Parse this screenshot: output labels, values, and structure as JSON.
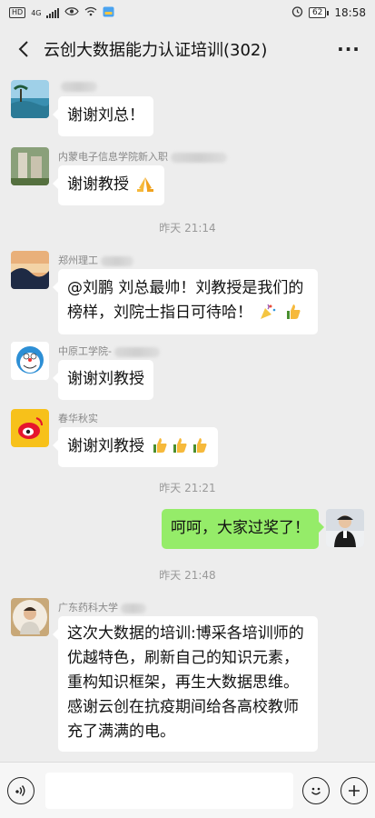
{
  "status_bar": {
    "hd_label": "HD",
    "network_label": "4G",
    "battery_level": "62",
    "time": "18:58"
  },
  "header": {
    "title": "云创大数据能力认证培训(302)",
    "more_label": "···"
  },
  "messages": [
    {
      "sender": "",
      "text": "谢谢刘总！"
    },
    {
      "sender": "内蒙电子信息学院新入职",
      "text": "谢谢教授"
    },
    {
      "time": "昨天 21:14"
    },
    {
      "sender": "郑州理工",
      "text_line1": "@刘鹏  刘总最帅！刘教授是我们的",
      "text_line2": "榜样，刘院士指日可待哈！"
    },
    {
      "sender": "中原工学院-",
      "text": "谢谢刘教授"
    },
    {
      "sender": "春华秋实",
      "text": "谢谢刘教授"
    },
    {
      "time": "昨天 21:21"
    },
    {
      "self": true,
      "text": "呵呵，大家过奖了！"
    },
    {
      "time": "昨天 21:48"
    },
    {
      "sender": "广东药科大学",
      "lines": [
        "这次大数据的培训:博采各培训师的",
        "优越特色，刷新自己的知识元素，",
        "重构知识框架，再生大数据思维。",
        "感谢云创在抗疫期间给各高校教师",
        "充了满满的电。"
      ]
    }
  ],
  "icons": {
    "back": "chevron-left-icon",
    "voice": "voice-icon",
    "emoji": "smiley-icon",
    "add": "plus-icon",
    "folded_hands": "folded-hands-icon",
    "party": "party-popper-icon",
    "thumbs_up": "thumbs-up-icon"
  },
  "colors": {
    "background": "#ededed",
    "self_bubble": "#95ec69",
    "other_bubble": "#ffffff",
    "meta_text": "#999999"
  }
}
